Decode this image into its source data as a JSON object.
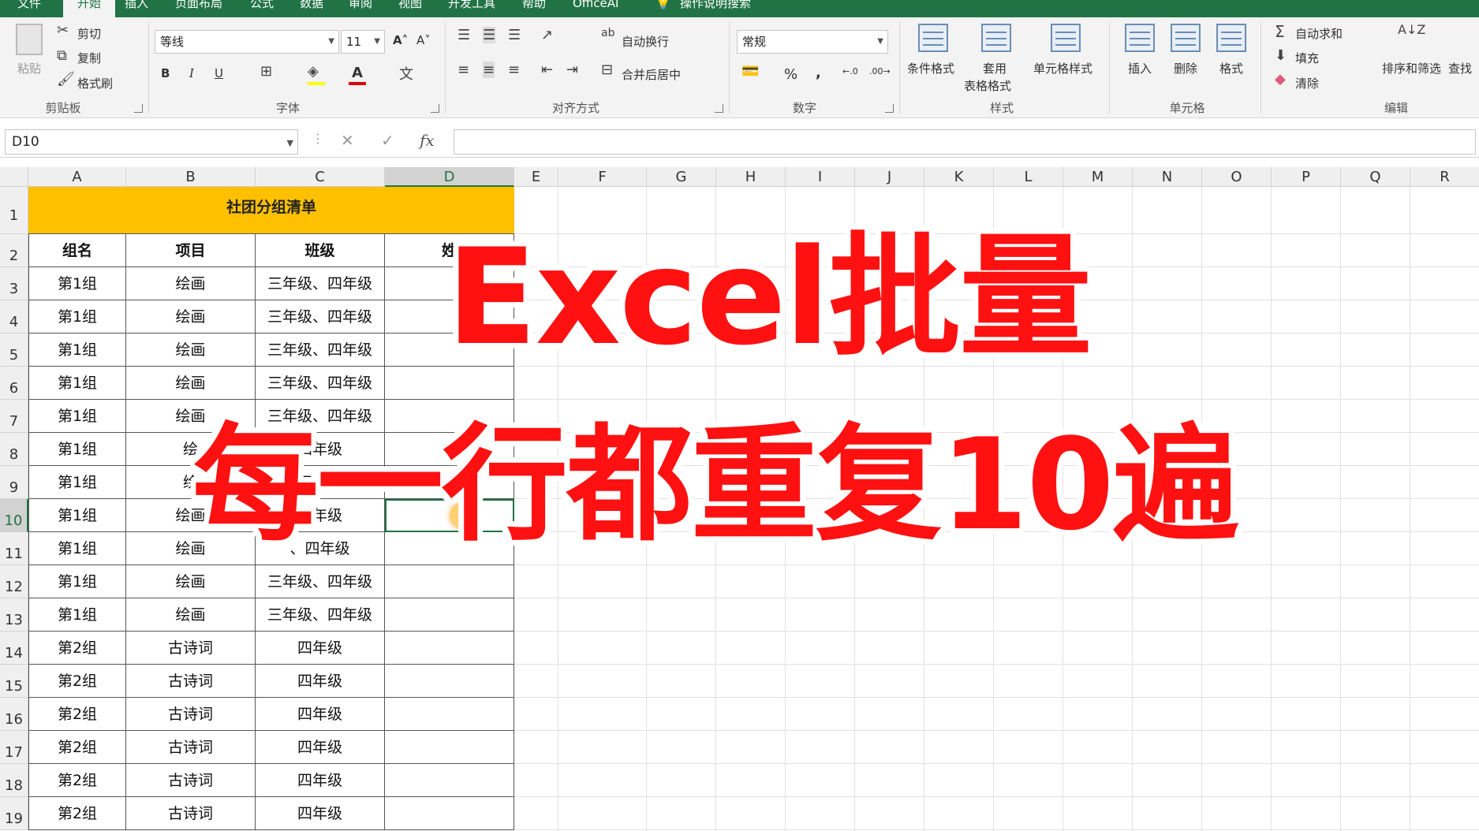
{
  "tabs": [
    "文件",
    "开始",
    "插入",
    "页面布局",
    "公式",
    "数据",
    "审阅",
    "视图",
    "开发工具",
    "帮助",
    "OfficeAI",
    "操作说明搜索"
  ],
  "active_tab": "开始",
  "ribbon": {
    "clipboard": {
      "paste": "粘贴",
      "cut": "剪切",
      "copy": "复制",
      "format_painter": "格式刷",
      "group": "剪贴板"
    },
    "font": {
      "name": "等线",
      "size": "11",
      "bold": "B",
      "italic": "I",
      "underline": "U",
      "group": "字体",
      "color_font": "#e00000",
      "color_fill": "#ffff00"
    },
    "alignment": {
      "wrap": "自动换行",
      "merge": "合并后居中",
      "group": "对齐方式"
    },
    "number": {
      "format": "常规",
      "percent": "%",
      "comma": ",",
      "group": "数字"
    },
    "styles": {
      "conditional": "条件格式",
      "table1": "套用",
      "table2": "表格格式",
      "cell_styles": "单元格样式",
      "group": "样式"
    },
    "cells": {
      "insert": "插入",
      "delete": "删除",
      "format": "格式",
      "group": "单元格"
    },
    "editing": {
      "autosum": "自动求和",
      "fill": "填充",
      "clear": "清除",
      "sort_filter": "排序和筛选",
      "find": "查找",
      "group": "编辑"
    }
  },
  "formula_bar": {
    "name_box": "D10",
    "fx": "fx"
  },
  "columns": [
    "A",
    "B",
    "C",
    "D",
    "E",
    "F",
    "G",
    "H",
    "I",
    "J",
    "K",
    "L",
    "M",
    "N",
    "O",
    "P",
    "Q",
    "R"
  ],
  "rows": [
    "1",
    "2",
    "3",
    "4",
    "5",
    "6",
    "7",
    "8",
    "9",
    "10",
    "11",
    "12",
    "13",
    "14",
    "15",
    "16",
    "17",
    "18",
    "19"
  ],
  "sheet": {
    "title": "社团分组清单",
    "headers": [
      "组名",
      "项目",
      "班级",
      "姓"
    ],
    "data": [
      [
        "第1组",
        "绘画",
        "三年级、四年级"
      ],
      [
        "第1组",
        "绘画",
        "三年级、四年级"
      ],
      [
        "第1组",
        "绘画",
        "三年级、四年级"
      ],
      [
        "第1组",
        "绘画",
        "三年级、四年级"
      ],
      [
        "第1组",
        "绘画",
        "三年级、四年级"
      ],
      [
        "第1组",
        "绘",
        "四年级"
      ],
      [
        "第1组",
        "绘",
        "四年级"
      ],
      [
        "第1组",
        "绘画",
        "四年级"
      ],
      [
        "第1组",
        "绘画",
        "、四年级"
      ],
      [
        "第1组",
        "绘画",
        "三年级、四年级"
      ],
      [
        "第1组",
        "绘画",
        "三年级、四年级"
      ],
      [
        "第2组",
        "古诗词",
        "四年级"
      ],
      [
        "第2组",
        "古诗词",
        "四年级"
      ],
      [
        "第2组",
        "古诗词",
        "四年级"
      ],
      [
        "第2组",
        "古诗词",
        "四年级"
      ],
      [
        "第2组",
        "古诗词",
        "四年级"
      ],
      [
        "第2组",
        "古诗词",
        "四年级"
      ]
    ]
  },
  "overlay": {
    "line1": "Excel批量",
    "line2": "每一行都重复10遍",
    "color": "#ff1111"
  },
  "colors": {
    "brand": "#217346",
    "title_fill": "#ffc000"
  }
}
